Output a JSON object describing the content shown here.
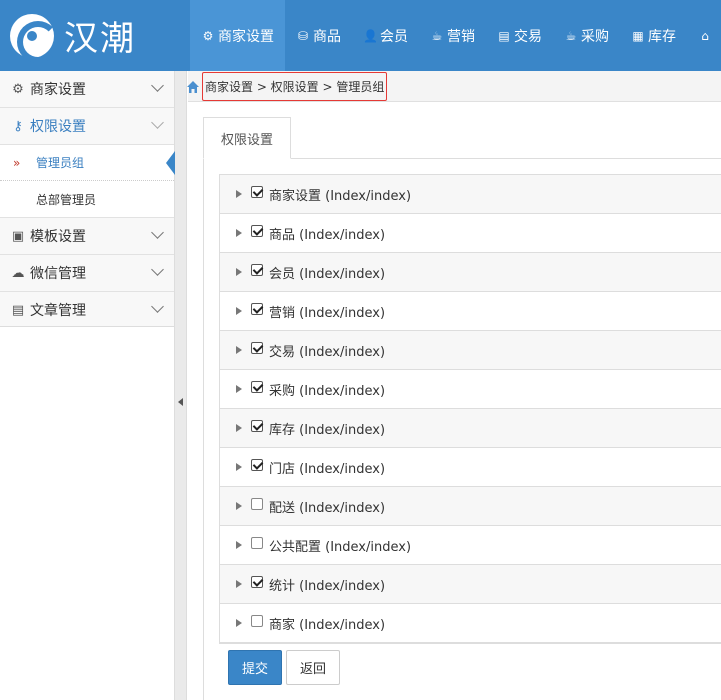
{
  "brand": {
    "name": "汉潮"
  },
  "nav": [
    {
      "label": "商家设置",
      "icon": "gear-icon",
      "glyph": "⚙",
      "active": true
    },
    {
      "label": "商品",
      "icon": "database-icon",
      "glyph": "⛁",
      "active": false
    },
    {
      "label": "会员",
      "icon": "user-icon",
      "glyph": "👤",
      "active": false
    },
    {
      "label": "营销",
      "icon": "cup-icon",
      "glyph": "☕",
      "active": false
    },
    {
      "label": "交易",
      "icon": "clipboard-icon",
      "glyph": "▤",
      "active": false
    },
    {
      "label": "采购",
      "icon": "cup-icon",
      "glyph": "☕",
      "active": false
    },
    {
      "label": "库存",
      "icon": "store-icon",
      "glyph": "▦",
      "active": false
    },
    {
      "label": "",
      "icon": "home-icon",
      "glyph": "⌂",
      "active": false
    }
  ],
  "sidebar": {
    "items": [
      {
        "label": "商家设置",
        "icon": "gear-icon",
        "glyph": "⚙"
      },
      {
        "label": "权限设置",
        "icon": "key-icon",
        "glyph": "⚷"
      },
      {
        "label": "模板设置",
        "icon": "template-icon",
        "glyph": "▣"
      },
      {
        "label": "微信管理",
        "icon": "wechat-icon",
        "glyph": "☁"
      },
      {
        "label": "文章管理",
        "icon": "article-icon",
        "glyph": "▤"
      }
    ],
    "subitems": [
      {
        "label": "管理员组",
        "marker": "»"
      },
      {
        "label": "总部管理员"
      }
    ]
  },
  "breadcrumb": {
    "text": "商家设置 > 权限设置 > 管理员组"
  },
  "tab": {
    "label": "权限设置"
  },
  "permissions": [
    {
      "label": "商家设置 (Index/index)",
      "checked": true
    },
    {
      "label": "商品 (Index/index)",
      "checked": true
    },
    {
      "label": "会员 (Index/index)",
      "checked": true
    },
    {
      "label": "营销 (Index/index)",
      "checked": true
    },
    {
      "label": "交易 (Index/index)",
      "checked": true
    },
    {
      "label": "采购 (Index/index)",
      "checked": true
    },
    {
      "label": "库存 (Index/index)",
      "checked": true
    },
    {
      "label": "门店 (Index/index)",
      "checked": true
    },
    {
      "label": "配送 (Index/index)",
      "checked": false
    },
    {
      "label": "公共配置 (Index/index)",
      "checked": false
    },
    {
      "label": "统计 (Index/index)",
      "checked": true
    },
    {
      "label": "商家 (Index/index)",
      "checked": false
    }
  ],
  "buttons": {
    "submit": "提交",
    "back": "返回"
  },
  "colors": {
    "primary": "#3a86c8",
    "nav_active": "#4a95d6",
    "highlight_border": "#e53935"
  }
}
